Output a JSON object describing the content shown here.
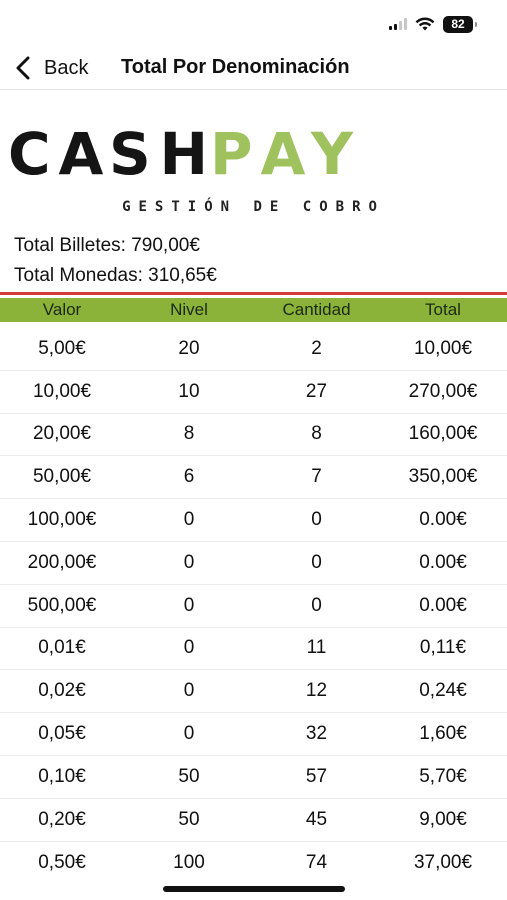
{
  "status_bar": {
    "battery": "82",
    "icons": [
      "signal-icon",
      "wifi-icon",
      "battery-icon"
    ]
  },
  "nav": {
    "back_label": "Back",
    "title": "Total Por Denominación"
  },
  "logo": {
    "letters_dark": [
      "C",
      "A",
      "S",
      "H"
    ],
    "letters_green": [
      "P",
      "A",
      "Y"
    ],
    "tagline": "GESTIÓN DE COBRO",
    "colors": {
      "dark": "#151515",
      "green": "#9fc25e"
    }
  },
  "totals": {
    "billetes": "Total Billetes: 790,00€",
    "monedas": "Total Monedas: 310,65€"
  },
  "table": {
    "header_color": "#8bb33a",
    "divider_color": "#d33a3a",
    "columns": [
      "Valor",
      "Nivel",
      "Cantidad",
      "Total"
    ],
    "rows": [
      [
        "5,00€",
        "20",
        "2",
        "10,00€"
      ],
      [
        "10,00€",
        "10",
        "27",
        "270,00€"
      ],
      [
        "20,00€",
        "8",
        "8",
        "160,00€"
      ],
      [
        "50,00€",
        "6",
        "7",
        "350,00€"
      ],
      [
        "100,00€",
        "0",
        "0",
        "0.00€"
      ],
      [
        "200,00€",
        "0",
        "0",
        "0.00€"
      ],
      [
        "500,00€",
        "0",
        "0",
        "0.00€"
      ],
      [
        "0,01€",
        "0",
        "11",
        "0,11€"
      ],
      [
        "0,02€",
        "0",
        "12",
        "0,24€"
      ],
      [
        "0,05€",
        "0",
        "32",
        "1,60€"
      ],
      [
        "0,10€",
        "50",
        "57",
        "5,70€"
      ],
      [
        "0,20€",
        "50",
        "45",
        "9,00€"
      ],
      [
        "0,50€",
        "100",
        "74",
        "37,00€"
      ]
    ]
  }
}
